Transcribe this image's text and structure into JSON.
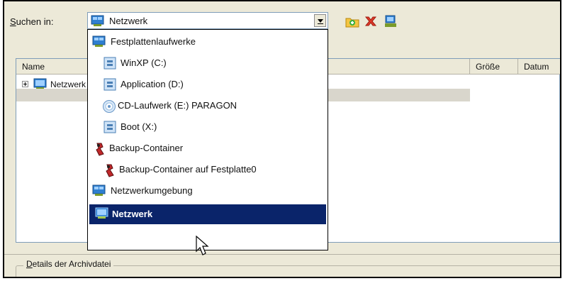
{
  "toolbar": {
    "search_label_accel": "S",
    "search_label_rest": "uchen in:",
    "location_value": "Netzwerk"
  },
  "dropdown": {
    "items": [
      {
        "label": "Festplattenlaufwerke",
        "icon": "network-places-icon"
      },
      {
        "label": "WinXP (C:)",
        "icon": "drive-icon"
      },
      {
        "label": "Application (D:)",
        "icon": "drive-icon"
      },
      {
        "label": "CD-Laufwerk (E:) PARAGON",
        "icon": "cd-drive-icon"
      },
      {
        "label": "Boot (X:)",
        "icon": "drive-icon"
      },
      {
        "label": "Backup-Container",
        "icon": "backup-container-icon"
      },
      {
        "label": "Backup-Container auf Festplatte0",
        "icon": "backup-container-icon"
      },
      {
        "label": "Netzwerkumgebung",
        "icon": "network-places-icon"
      },
      {
        "label": "Netzwerk",
        "icon": "network-icon",
        "selected": true
      }
    ]
  },
  "listview": {
    "columns": [
      "Name",
      "Größe",
      "Datum"
    ],
    "tree_item": "Netzwerk"
  },
  "details": {
    "legend_accel": "D",
    "legend_rest": "etails der Archivdatei"
  },
  "colors": {
    "selection": "#0a246a",
    "dialog_bg": "#ece9d8"
  }
}
